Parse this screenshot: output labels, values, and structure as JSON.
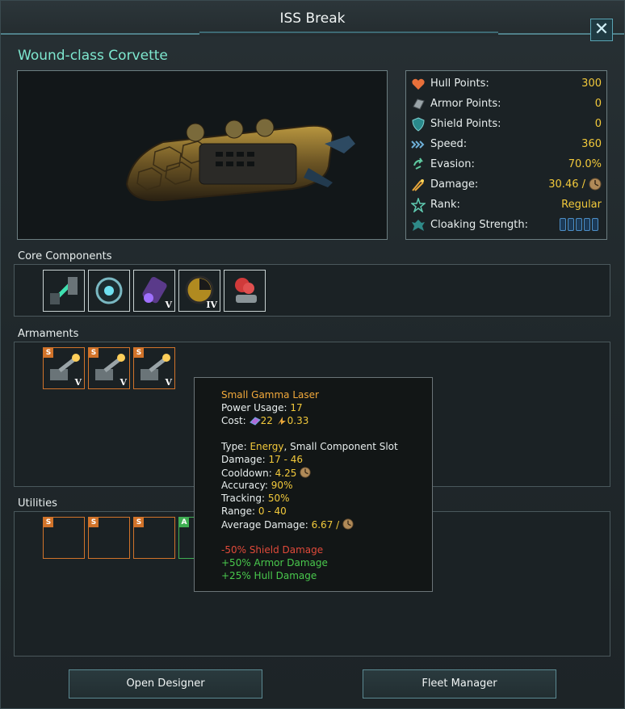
{
  "window": {
    "title": "ISS Break",
    "close_label": "✕"
  },
  "ship": {
    "class_name": "Wound-class Corvette"
  },
  "stats": [
    {
      "icon": "heart-icon",
      "label": "Hull Points:",
      "value": "300"
    },
    {
      "icon": "armor-icon",
      "label": "Armor Points:",
      "value": "0"
    },
    {
      "icon": "shield-icon",
      "label": "Shield Points:",
      "value": "0"
    },
    {
      "icon": "speed-icon",
      "label": "Speed:",
      "value": "360"
    },
    {
      "icon": "evasion-icon",
      "label": "Evasion:",
      "value": "70.0%"
    },
    {
      "icon": "damage-icon",
      "label": "Damage:",
      "value": "30.46 /"
    },
    {
      "icon": "rank-star-icon",
      "label": "Rank:",
      "value": "Regular"
    },
    {
      "icon": "cloak-icon",
      "label": "Cloaking Strength:",
      "value": ""
    }
  ],
  "cloaking": {
    "segments": 5,
    "filled": 0
  },
  "sections": {
    "core": "Core Components",
    "armaments": "Armaments",
    "utilities": "Utilities"
  },
  "core_components": [
    {
      "icon": "thruster-icon",
      "tier": ""
    },
    {
      "icon": "sensor-icon",
      "tier": ""
    },
    {
      "icon": "reactor-icon",
      "tier": "V"
    },
    {
      "icon": "hyperdrive-icon",
      "tier": "IV"
    },
    {
      "icon": "combat-computer-icon",
      "tier": ""
    }
  ],
  "armaments": [
    {
      "size": "S",
      "icon": "laser-turret-icon",
      "tier": "V"
    },
    {
      "size": "S",
      "icon": "laser-turret-icon",
      "tier": "V"
    },
    {
      "size": "S",
      "icon": "laser-turret-icon",
      "tier": "V"
    }
  ],
  "utilities": [
    {
      "size": "S"
    },
    {
      "size": "S"
    },
    {
      "size": "S"
    },
    {
      "size": "A"
    }
  ],
  "tooltip": {
    "name": "Small Gamma Laser",
    "power_label": "Power Usage:",
    "power_value": "17",
    "cost_label": "Cost:",
    "cost_alloys": "22",
    "cost_energy": "0.33",
    "type_label": "Type:",
    "type_value": "Energy",
    "type_slot": ", Small Component Slot",
    "damage_label": "Damage:",
    "damage_value": "17 - 46",
    "cooldown_label": "Cooldown:",
    "cooldown_value": "4.25",
    "accuracy_label": "Accuracy:",
    "accuracy_value": "90%",
    "tracking_label": "Tracking:",
    "tracking_value": "50%",
    "range_label": "Range:",
    "range_value": "0 - 40",
    "avg_label": "Average Damage:",
    "avg_value": "6.67 /",
    "mod_shield": "-50% Shield Damage",
    "mod_armor": "+50% Armor Damage",
    "mod_hull": "+25% Hull Damage"
  },
  "buttons": {
    "open_designer": "Open Designer",
    "fleet_manager": "Fleet Manager"
  },
  "colors": {
    "accent_teal": "#7ee8d0",
    "value_yellow": "#f2c93b",
    "slot_orange": "#d1732a",
    "slot_green": "#3fae52",
    "negative_red": "#e04a3a",
    "positive_green": "#49c94d"
  }
}
